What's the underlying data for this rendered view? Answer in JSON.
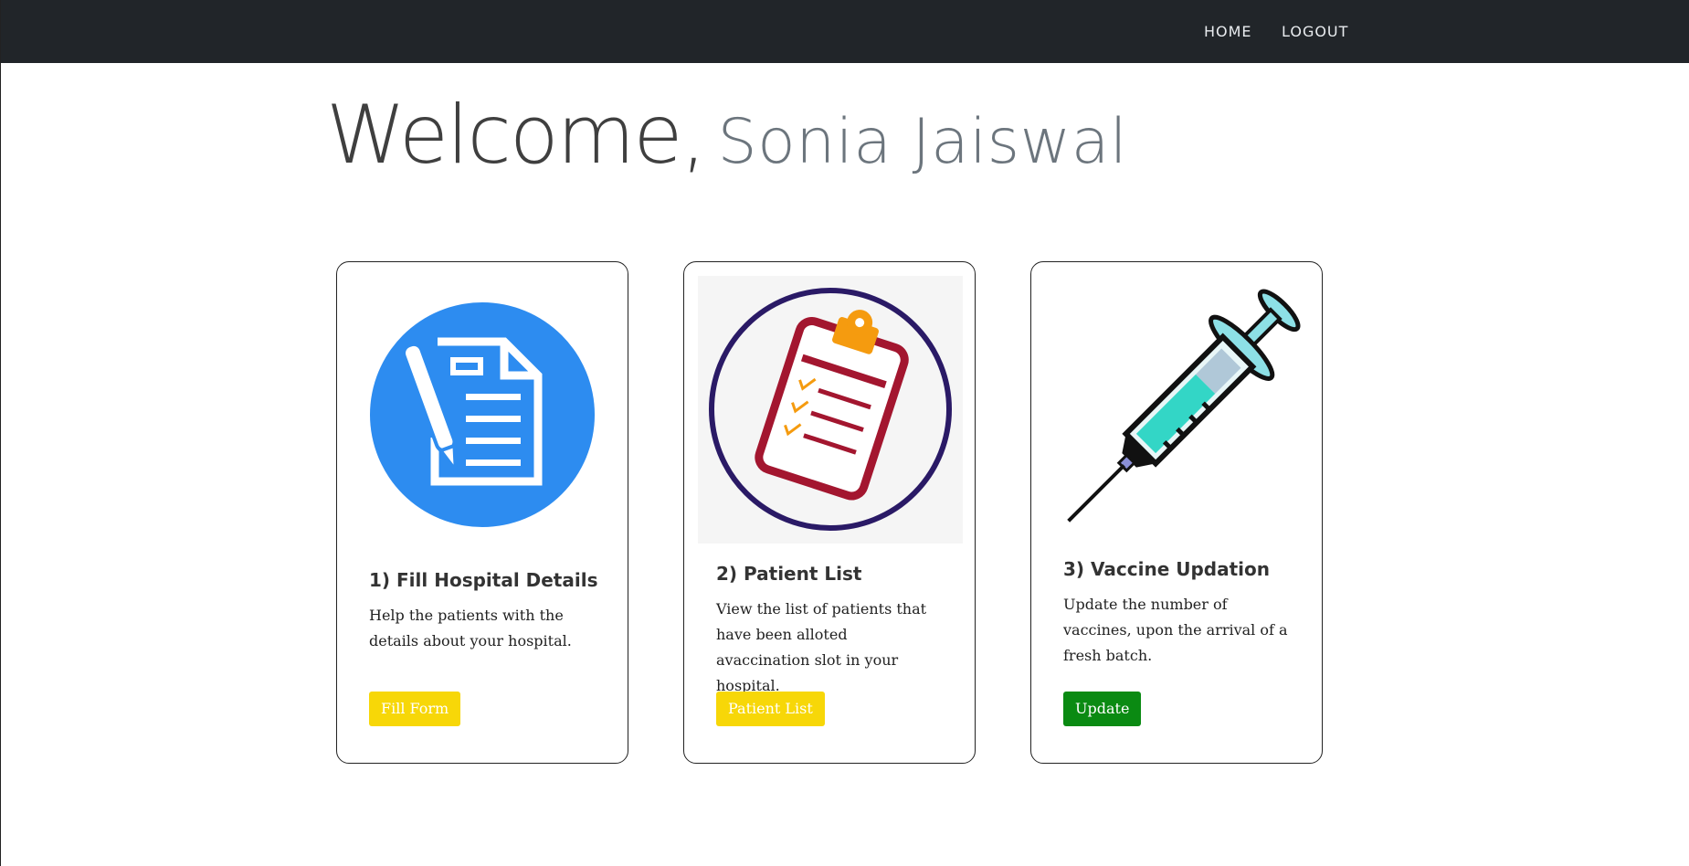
{
  "nav": {
    "home_label": "HOME",
    "logout_label": "LOGOUT"
  },
  "welcome": {
    "greeting": "Welcome,",
    "user_name": "Sonia Jaiswal"
  },
  "cards": [
    {
      "title": "1) Fill Hospital Details",
      "text": "Help the patients with the details about your hospital.",
      "button_label": "Fill Form",
      "icon": "document-pen-icon"
    },
    {
      "title": "2) Patient List",
      "text": "View the list of patients that have been alloted avaccination slot in your hospital.",
      "button_label": "Patient List",
      "icon": "clipboard-checklist-icon"
    },
    {
      "title": "3) Vaccine Updation",
      "text": "Update the number of vaccines, upon the arrival of a fresh batch.",
      "button_label": "Update",
      "icon": "syringe-icon"
    }
  ],
  "colors": {
    "navbar": "#212529",
    "fill_form_button": "#f7d708",
    "patient_list_button": "#f7d708",
    "update_button": "#0a8a12",
    "form_icon_circle": "#2d8cf0"
  }
}
